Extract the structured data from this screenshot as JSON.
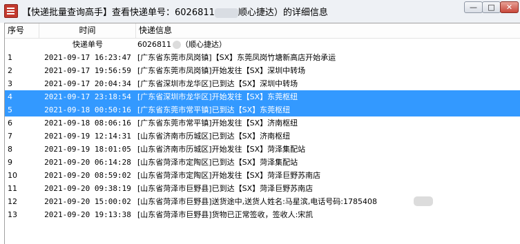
{
  "window": {
    "title_part1": "【快递批量查询高手】查看快递单号：6026811",
    "title_part2": "顺心捷达）的详细信息",
    "controls": {
      "minimize": "—",
      "maximize": "□",
      "close": "✕"
    }
  },
  "table": {
    "headers": {
      "no": "序号",
      "time": "时间",
      "info": "快递信息"
    },
    "first_row": {
      "time": "快递单号",
      "tracking_prefix": "6026811",
      "courier": "（顺心捷达）"
    },
    "rows": [
      {
        "no": "1",
        "time": "2021-09-17 16:23:47",
        "info": "[广东省东莞市凤岗镇]【SX】东莞凤岗竹塘新高店开始承运"
      },
      {
        "no": "2",
        "time": "2021-09-17 19:56:59",
        "info": "[广东省东莞市凤岗镇]开始发往【SX】深圳中转场"
      },
      {
        "no": "3",
        "time": "2021-09-17 20:04:34",
        "info": "[广东省深圳市龙华区]已到达【SX】深圳中转场"
      },
      {
        "no": "4",
        "time": "2021-09-17 23:18:54",
        "info": "[广东省深圳市龙华区]开始发往【SX】东莞枢纽"
      },
      {
        "no": "5",
        "time": "2021-09-18 00:50:16",
        "info": "[广东省东莞市常平镇]已到达【SX】东莞枢纽"
      },
      {
        "no": "6",
        "time": "2021-09-18 08:06:16",
        "info": "[广东省东莞市常平镇]开始发往【SX】济南枢纽"
      },
      {
        "no": "7",
        "time": "2021-09-19 12:14:31",
        "info": "[山东省济南市历城区]已到达【SX】济南枢纽"
      },
      {
        "no": "8",
        "time": "2021-09-19 18:01:05",
        "info": "[山东省济南市历城区]开始发往【SX】菏泽集配站"
      },
      {
        "no": "9",
        "time": "2021-09-20 06:14:28",
        "info": "[山东省菏泽市定陶区]已到达【SX】菏泽集配站"
      },
      {
        "no": "10",
        "time": "2021-09-20 08:59:02",
        "info": "[山东省菏泽市定陶区]开始发往【SX】菏泽巨野苏南店"
      },
      {
        "no": "11",
        "time": "2021-09-20 09:38:19",
        "info": "[山东省菏泽市巨野县]已到达【SX】菏泽巨野苏南店"
      },
      {
        "no": "12",
        "time": "2021-09-20 15:00:02",
        "info": "[山东省菏泽市巨野县]送货途中,送货人姓名:马星滨,电话号码:1785408"
      },
      {
        "no": "13",
        "time": "2021-09-20 19:13:38",
        "info": "[山东省菏泽市巨野县]货物已正常签收，签收人:宋凯"
      }
    ],
    "selected_rows": [
      "4",
      "5"
    ]
  },
  "colors": {
    "selection": "#3399ff"
  }
}
